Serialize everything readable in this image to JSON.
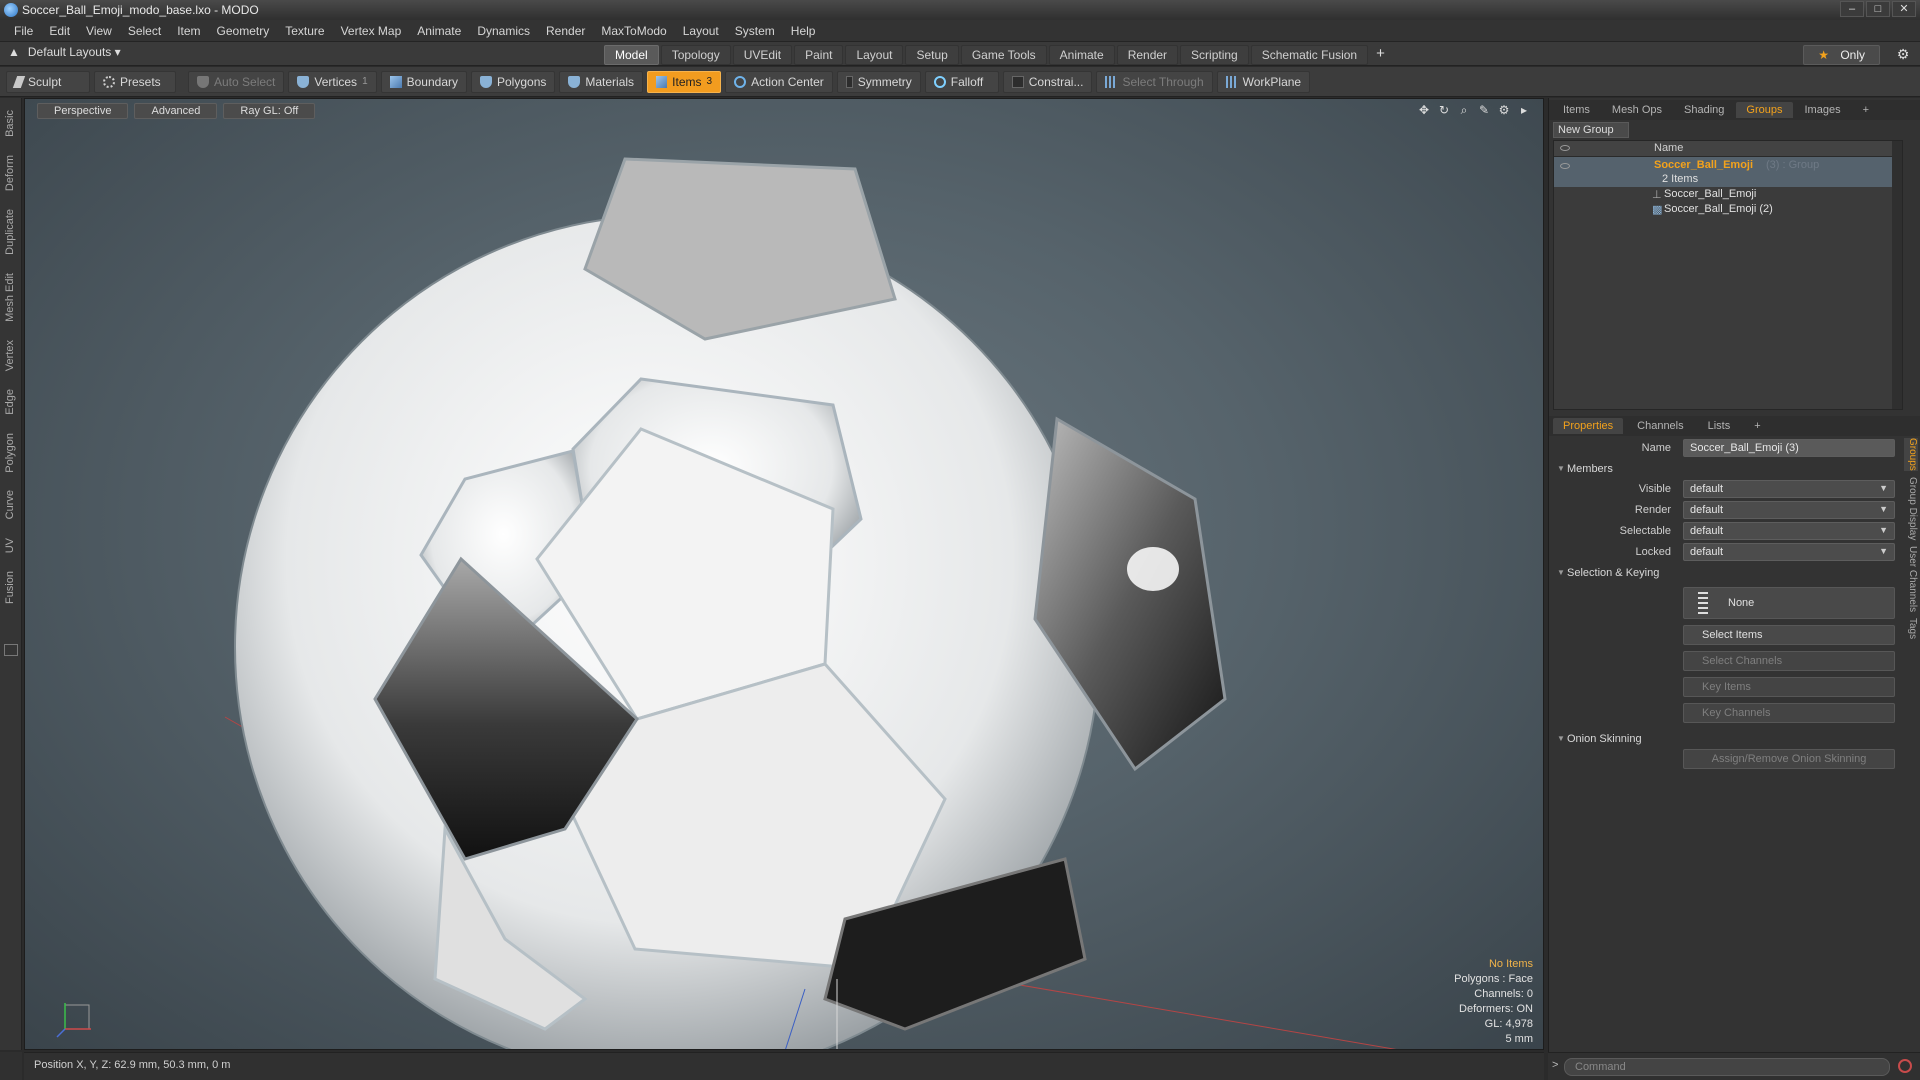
{
  "window": {
    "title": "Soccer_Ball_Emoji_modo_base.lxo - MODO",
    "buttons": [
      "–",
      "□",
      "✕"
    ]
  },
  "menu": [
    "File",
    "Edit",
    "View",
    "Select",
    "Item",
    "Geometry",
    "Texture",
    "Vertex Map",
    "Animate",
    "Dynamics",
    "Render",
    "MaxToModo",
    "Layout",
    "System",
    "Help"
  ],
  "layoutbar": {
    "layout_select": "Default Layouts ▾",
    "tabs": [
      "Model",
      "Topology",
      "UVEdit",
      "Paint",
      "Layout",
      "Setup",
      "Game Tools",
      "Animate",
      "Render",
      "Scripting",
      "Schematic Fusion"
    ],
    "active_tab": "Model",
    "plus": "+",
    "only_label": "Only",
    "only_icon": "★",
    "gear": "⚙"
  },
  "toolbar": {
    "sculpt": "Sculpt",
    "presets": "Presets",
    "auto_select": "Auto Select",
    "vertices": "Vertices",
    "vertices_count": "1",
    "boundary": "Boundary",
    "polygons": "Polygons",
    "materials": "Materials",
    "items": "Items",
    "items_count": "3",
    "action_center": "Action Center",
    "symmetry": "Symmetry",
    "falloff": "Falloff",
    "constraints": "Constrai...",
    "select_through": "Select Through",
    "workplane": "WorkPlane"
  },
  "left_tabs": [
    "Basic",
    "Deform",
    "Duplicate",
    "Mesh Edit",
    "Vertex",
    "Edge",
    "Polygon",
    "Curve",
    "UV",
    "Fusion"
  ],
  "viewport": {
    "buttons": [
      "Perspective",
      "Advanced",
      "Ray GL: Off"
    ],
    "icons": [
      "✥",
      "↻",
      "⌕",
      "✎",
      "⚙",
      "▸"
    ],
    "info": {
      "no_items": "No Items",
      "polygons": "Polygons : Face",
      "channels": "Channels: 0",
      "deformers": "Deformers: ON",
      "gl": "GL: 4,978",
      "scale": "5 mm"
    }
  },
  "status": {
    "position": "Position X, Y, Z:   62.9 mm, 50.3 mm, 0 m"
  },
  "right_panel": {
    "tabs": [
      "Items",
      "Mesh Ops",
      "Shading",
      "Groups",
      "Images",
      "+"
    ],
    "active_tab": "Groups",
    "new_group": "New Group",
    "list_header": "Name",
    "group": {
      "name": "Soccer_Ball_Emoji",
      "meta": "(3) : Group",
      "items": "2 Items"
    },
    "children": [
      "Soccer_Ball_Emoji",
      "Soccer_Ball_Emoji (2)"
    ],
    "prop_tabs": [
      "Properties",
      "Channels",
      "Lists",
      "+"
    ],
    "prop_active": "Properties",
    "name_label": "Name",
    "name_value": "Soccer_Ball_Emoji (3)",
    "members": "Members",
    "visible_label": "Visible",
    "render_label": "Render",
    "selectable_label": "Selectable",
    "locked_label": "Locked",
    "default": "default",
    "selection_keying": "Selection & Keying",
    "none": "None",
    "select_items": "Select Items",
    "select_channels": "Select Channels",
    "key_items": "Key Items",
    "key_channels": "Key Channels",
    "onion": "Onion Skinning",
    "onion_btn": "Assign/Remove Onion Skinning",
    "vertical_tabs": [
      "Groups",
      "Group Display",
      "User Channels",
      "Tags"
    ]
  },
  "command": {
    "placeholder": "Command",
    "prompt": ">"
  }
}
